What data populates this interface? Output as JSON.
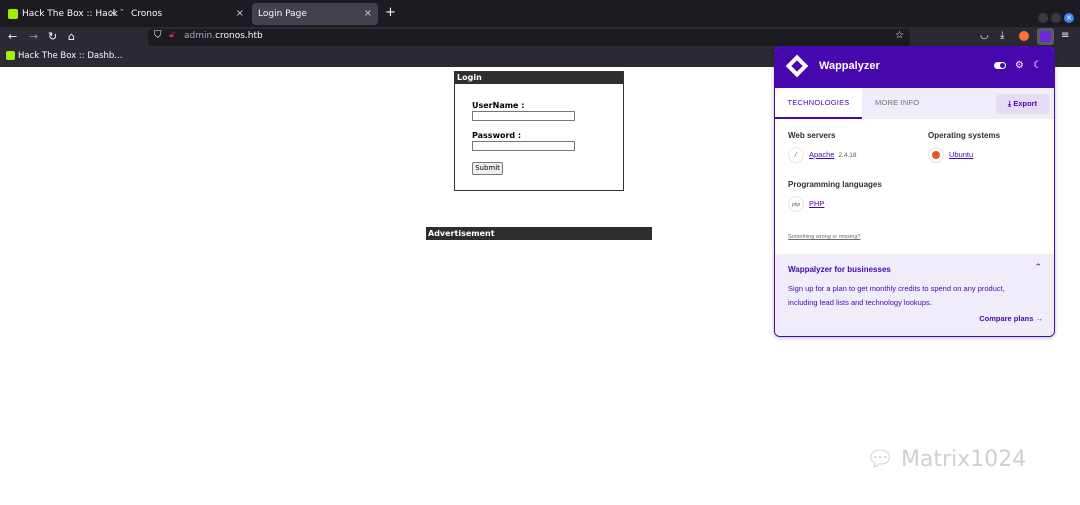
{
  "browser": {
    "tabs": [
      {
        "title": "Hack The Box :: Hack The B"
      },
      {
        "title": "Cronos"
      },
      {
        "title": "Login Page"
      }
    ],
    "new_tab": "+",
    "close": "×",
    "url_prefix": "admin.",
    "url_host": "cronos.htb",
    "bookmark": "Hack The Box :: Dashb..."
  },
  "login": {
    "heading": "Login",
    "username_label": "UserName :",
    "password_label": "Password :",
    "submit": "Submit"
  },
  "ad": {
    "label": "Advertisement"
  },
  "wappalyzer": {
    "title": "Wappalyzer",
    "tabs": {
      "technologies": "TECHNOLOGIES",
      "more_info": "MORE INFO"
    },
    "export": "Export",
    "categories": {
      "web_servers": "Web servers",
      "operating_systems": "Operating systems",
      "programming_languages": "Programming languages"
    },
    "tech": {
      "apache": {
        "name": "Apache",
        "version": "2.4.18"
      },
      "ubuntu": {
        "name": "Ubuntu"
      },
      "php": {
        "name": "PHP",
        "icon_text": "php"
      }
    },
    "missing": "Something wrong or missing?",
    "business": {
      "title": "Wappalyzer for businesses",
      "text": "Sign up for a plan to get monthly credits to spend on any product, including lead lists and technology lookups.",
      "cta": "Compare plans"
    },
    "brand_color": "#4608ad"
  },
  "watermark": "Matrix1024"
}
